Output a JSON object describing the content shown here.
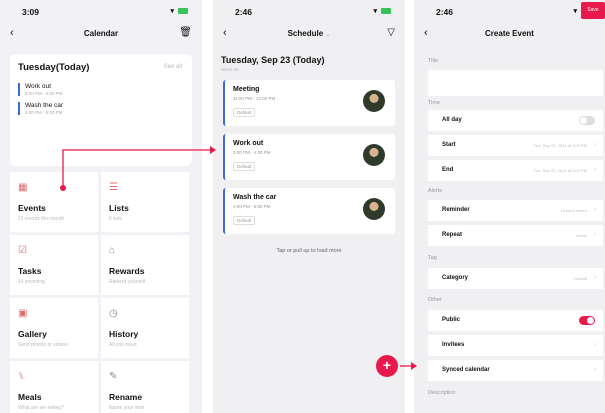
{
  "phone1": {
    "status_time": "3:09",
    "title": "Calendar",
    "today_card": {
      "heading": "Tuesday(Today)",
      "see_all": "See all",
      "events": [
        {
          "title": "Work out",
          "time": "3:00 PM - 4:00 PM"
        },
        {
          "title": "Wash the car",
          "time": "4:00 PM - 5:00 PM"
        }
      ]
    },
    "tiles": [
      {
        "name": "Events",
        "sub": "21 events this month",
        "icon": "calendar-icon"
      },
      {
        "name": "Lists",
        "sub": "5 lists",
        "icon": "list-icon"
      },
      {
        "name": "Tasks",
        "sub": "14 incoming",
        "icon": "checkbox-icon"
      },
      {
        "name": "Rewards",
        "sub": "Reward yourself",
        "icon": "gift-icon"
      },
      {
        "name": "Gallery",
        "sub": "Send photos or videos",
        "icon": "image-icon"
      },
      {
        "name": "History",
        "sub": "All you need",
        "icon": "clock-icon"
      },
      {
        "name": "Meals",
        "sub": "What are we eating?",
        "icon": "utensils-icon"
      },
      {
        "name": "Rename",
        "sub": "Name your item",
        "icon": "pencil-icon"
      }
    ]
  },
  "phone2": {
    "status_time": "2:46",
    "title": "Schedule",
    "date_heading": "Tuesday, Sep 23 (Today)",
    "date_sub": "Week 39",
    "events": [
      {
        "title": "Meeting",
        "time": "11:00 PM - 12:00 PM",
        "tag": "Default"
      },
      {
        "title": "Work out",
        "time": "3:00 PM - 4:00 PM",
        "tag": "Default"
      },
      {
        "title": "Wash the car",
        "time": "4:00 PM - 5:00 PM",
        "tag": "Default"
      }
    ],
    "load_more": "Tap or pull up to load more"
  },
  "phone3": {
    "status_time": "2:46",
    "title": "Create Event",
    "save": "Save",
    "sections": {
      "title": "Title",
      "time": "Time",
      "alerts": "Alerts",
      "tag": "Tag",
      "other": "Other",
      "description": "Description"
    },
    "rows": {
      "all_day": "All day",
      "start": "Start",
      "start_value": "Tue, Sep 23, 2014 at 3:00 PM",
      "end": "End",
      "end_value": "Tue, Sep 23, 2014 at 4:00 PM",
      "reminder": "Reminder",
      "reminder_value": "15 mins before",
      "repeat": "Repeat",
      "repeat_value": "Never",
      "category": "Category",
      "category_value": "Default",
      "public": "Public",
      "invitees": "Invitees",
      "synced_calendar": "Synced calendar"
    }
  },
  "colors": {
    "accent": "#e8194c",
    "event_bar": "#3b6bd6"
  }
}
